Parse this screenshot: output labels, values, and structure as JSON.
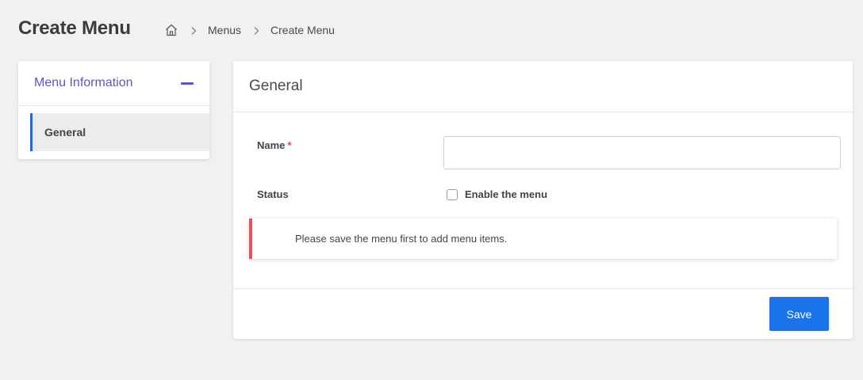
{
  "page": {
    "title": "Create Menu"
  },
  "breadcrumb": {
    "home_icon": "home-icon",
    "separator_icon": "chevron-right-icon",
    "items": [
      "Menus",
      "Create Menu"
    ]
  },
  "sidebar": {
    "title": "Menu Information",
    "collapse_icon": "minus-icon",
    "items": [
      {
        "label": "General",
        "active": true
      }
    ],
    "accent_color": "#5b57c9",
    "active_border_color": "#2b64d6"
  },
  "form": {
    "section_title": "General",
    "name": {
      "label": "Name",
      "required_marker": "*",
      "value": "",
      "placeholder": ""
    },
    "status": {
      "label": "Status",
      "checkbox_label": "Enable the menu",
      "checked": false
    },
    "notice": {
      "text": "Please save the menu first to add menu items.",
      "border_color": "#e8505b"
    },
    "save_label": "Save",
    "save_color": "#1a73e8"
  }
}
